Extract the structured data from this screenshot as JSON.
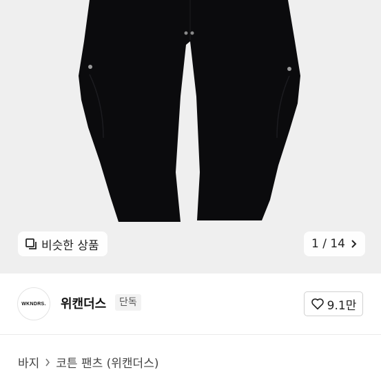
{
  "gallery": {
    "similar_label": "비슷한 상품",
    "current": "1",
    "total": "14",
    "separator": "/"
  },
  "seller": {
    "logo_text": "WKNDRS.",
    "name": "위캔더스",
    "badge": "단독",
    "likes": "9.1만"
  },
  "breadcrumb": {
    "category": "바지",
    "subcategory": "코튼 팬츠 (위캔더스)"
  },
  "icons": {
    "similar": "similar-products-icon",
    "next": "chevron-right-icon",
    "like": "heart-icon",
    "crumb": "chevron-right-icon"
  }
}
